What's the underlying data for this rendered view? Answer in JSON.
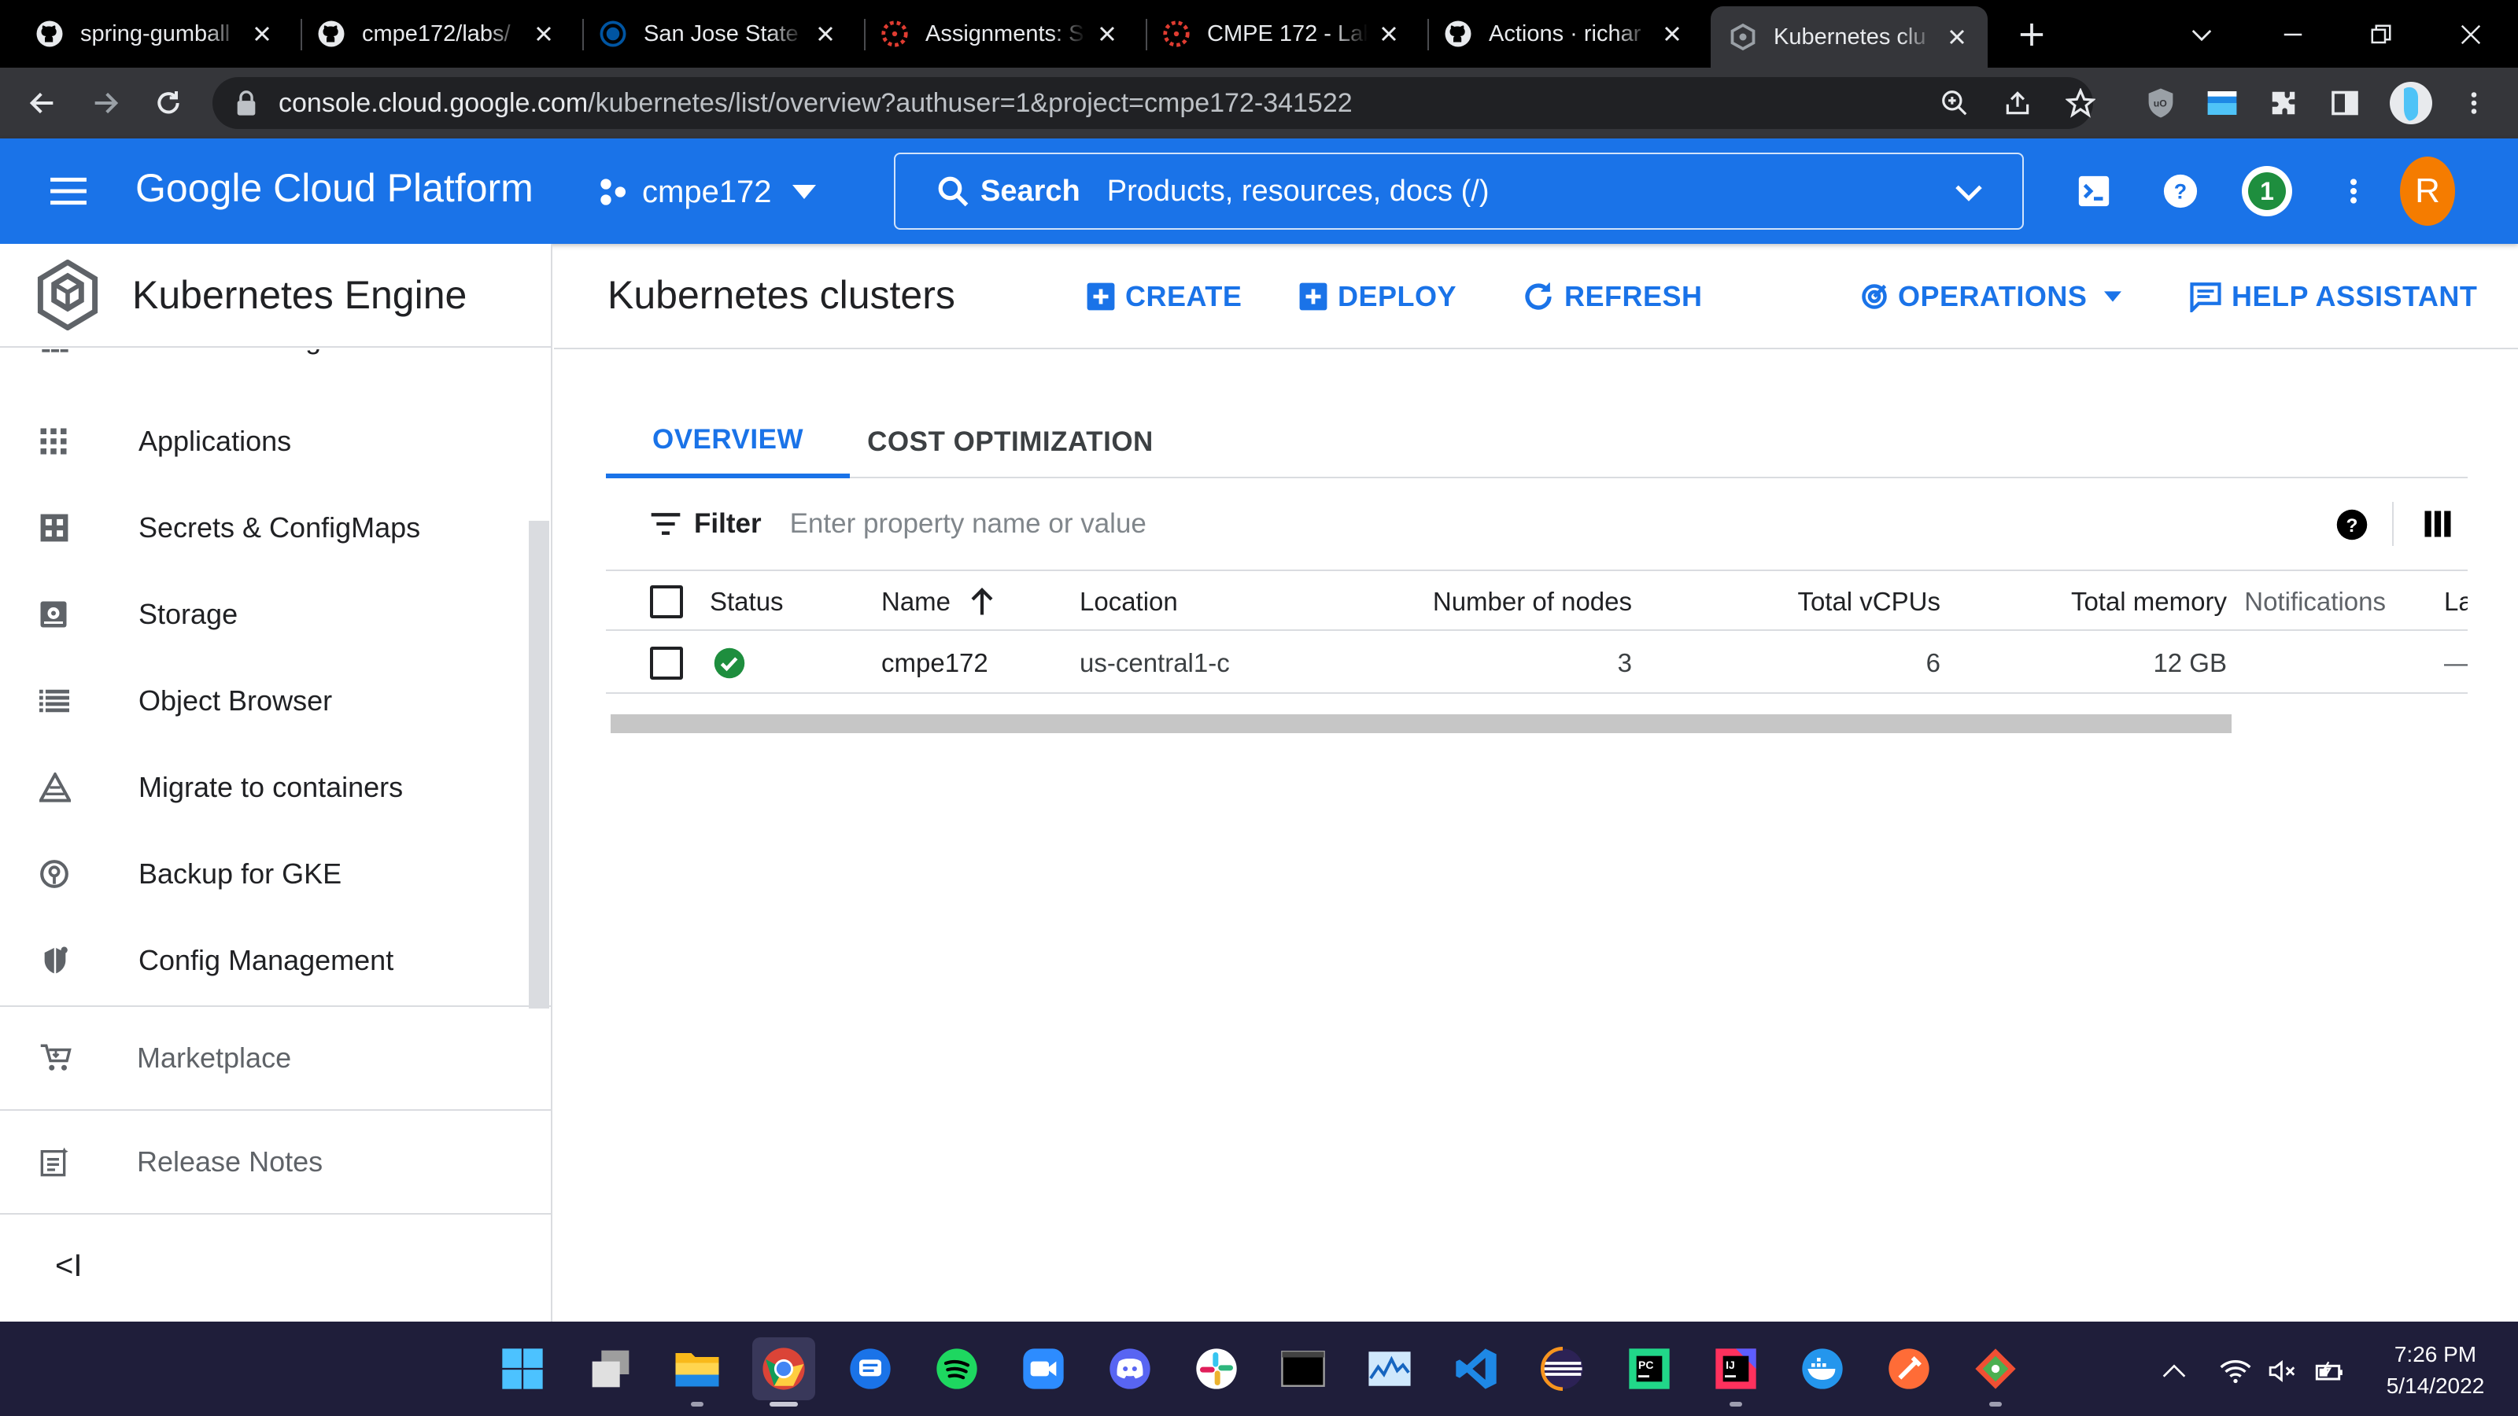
{
  "browser": {
    "tabs": [
      {
        "title": "spring-gumball",
        "icon": "github-icon"
      },
      {
        "title": "cmpe172/labs/",
        "icon": "github-icon"
      },
      {
        "title": "San Jose State",
        "icon": "sjsu-icon"
      },
      {
        "title": "Assignments: S",
        "icon": "canvas-icon"
      },
      {
        "title": "CMPE 172 - Lab",
        "icon": "canvas-icon"
      },
      {
        "title": "Actions · richar",
        "icon": "github-icon"
      },
      {
        "title": "Kubernetes clu",
        "icon": "gcp-icon"
      }
    ],
    "active_tab": 6,
    "url_host": "console.cloud.google.com",
    "url_path": "/kubernetes/list/overview?authuser=1&project=cmpe172-341522"
  },
  "header": {
    "brand": "Google Cloud Platform",
    "project": "cmpe172",
    "search_label": "Search",
    "search_placeholder": "Products, resources, docs (/)",
    "notification_count": "1",
    "avatar_letter": "R",
    "colors": {
      "primary": "#1a73e8",
      "avatar": "#f57c00",
      "badge": "#1e8e3e"
    }
  },
  "leftnav": {
    "title": "Kubernetes Engine",
    "items": [
      {
        "label": "Services & Ingress",
        "icon": "services-icon"
      },
      {
        "label": "Applications",
        "icon": "apps-grid-icon"
      },
      {
        "label": "Secrets & ConfigMaps",
        "icon": "secrets-icon"
      },
      {
        "label": "Storage",
        "icon": "storage-icon"
      },
      {
        "label": "Object Browser",
        "icon": "list-icon"
      },
      {
        "label": "Migrate to containers",
        "icon": "migrate-icon"
      },
      {
        "label": "Backup for GKE",
        "icon": "backup-icon"
      },
      {
        "label": "Config Management",
        "icon": "config-icon"
      }
    ],
    "marketplace": "Marketplace",
    "release_notes": "Release Notes",
    "collapse": "<I"
  },
  "main": {
    "title": "Kubernetes clusters",
    "actions": {
      "create": "CREATE",
      "deploy": "DEPLOY",
      "refresh": "REFRESH",
      "operations": "OPERATIONS",
      "help": "HELP ASSISTANT"
    },
    "tabs": [
      {
        "label": "OVERVIEW"
      },
      {
        "label": "COST OPTIMIZATION"
      }
    ],
    "filter_label": "Filter",
    "filter_placeholder": "Enter property name or value",
    "table": {
      "headers": {
        "status": "Status",
        "name": "Name",
        "location": "Location",
        "nodes": "Number of nodes",
        "vcpus": "Total vCPUs",
        "memory": "Total memory",
        "notifications": "Notifications",
        "labels": "La"
      },
      "rows": [
        {
          "name": "cmpe172",
          "location": "us-central1-c",
          "nodes": "3",
          "vcpus": "6",
          "memory": "12 GB",
          "notifications": "",
          "labels": "—"
        }
      ]
    }
  },
  "taskbar": {
    "time": "7:26 PM",
    "date": "5/14/2022"
  }
}
